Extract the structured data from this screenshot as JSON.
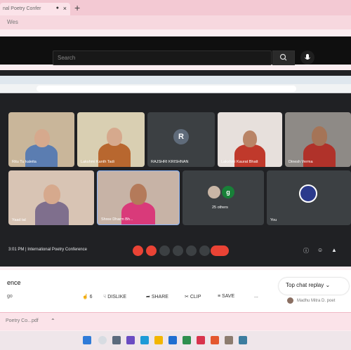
{
  "browser": {
    "tab_title": "nal Poetry Confer",
    "address_text": "Wes"
  },
  "youtube": {
    "search_placeholder": "Search"
  },
  "meet": {
    "participants": [
      {
        "label": "Ritu Tu kaleita"
      },
      {
        "label": "Lakshmi Kanth Tadi"
      },
      {
        "label": "RAJSHRI KRISHNAN",
        "avatar_letter": "R"
      },
      {
        "label": "Lakshmi Kaurat Bhatt"
      },
      {
        "label": "Dinesh Verma"
      },
      {
        "label": "Yaad tal"
      },
      {
        "label": "Shree Dharm Bh..."
      },
      {
        "label": "25 others",
        "avatar_letter": "g"
      },
      {
        "label": "You"
      }
    ],
    "status_text": "3:01 PM  |  International Poetry Conference"
  },
  "video_page": {
    "title_fragment": "ence",
    "subline_fragment": "go",
    "actions": {
      "likes": "6",
      "dislike": "DISLIKE",
      "share": "SHARE",
      "clip": "CLIP",
      "save": "SAVE",
      "more": "..."
    },
    "chat_replay_label": "Top chat replay",
    "chat_name": "Madhu Mitra D. poet"
  },
  "downloads": {
    "item_label": "Poetry Co...pdf"
  },
  "colors": {
    "youtube_bg": "#0f0f0f",
    "meet_bg": "#202124",
    "end_call": "#ea4335",
    "chrome_pink": "#f3c9d3"
  }
}
